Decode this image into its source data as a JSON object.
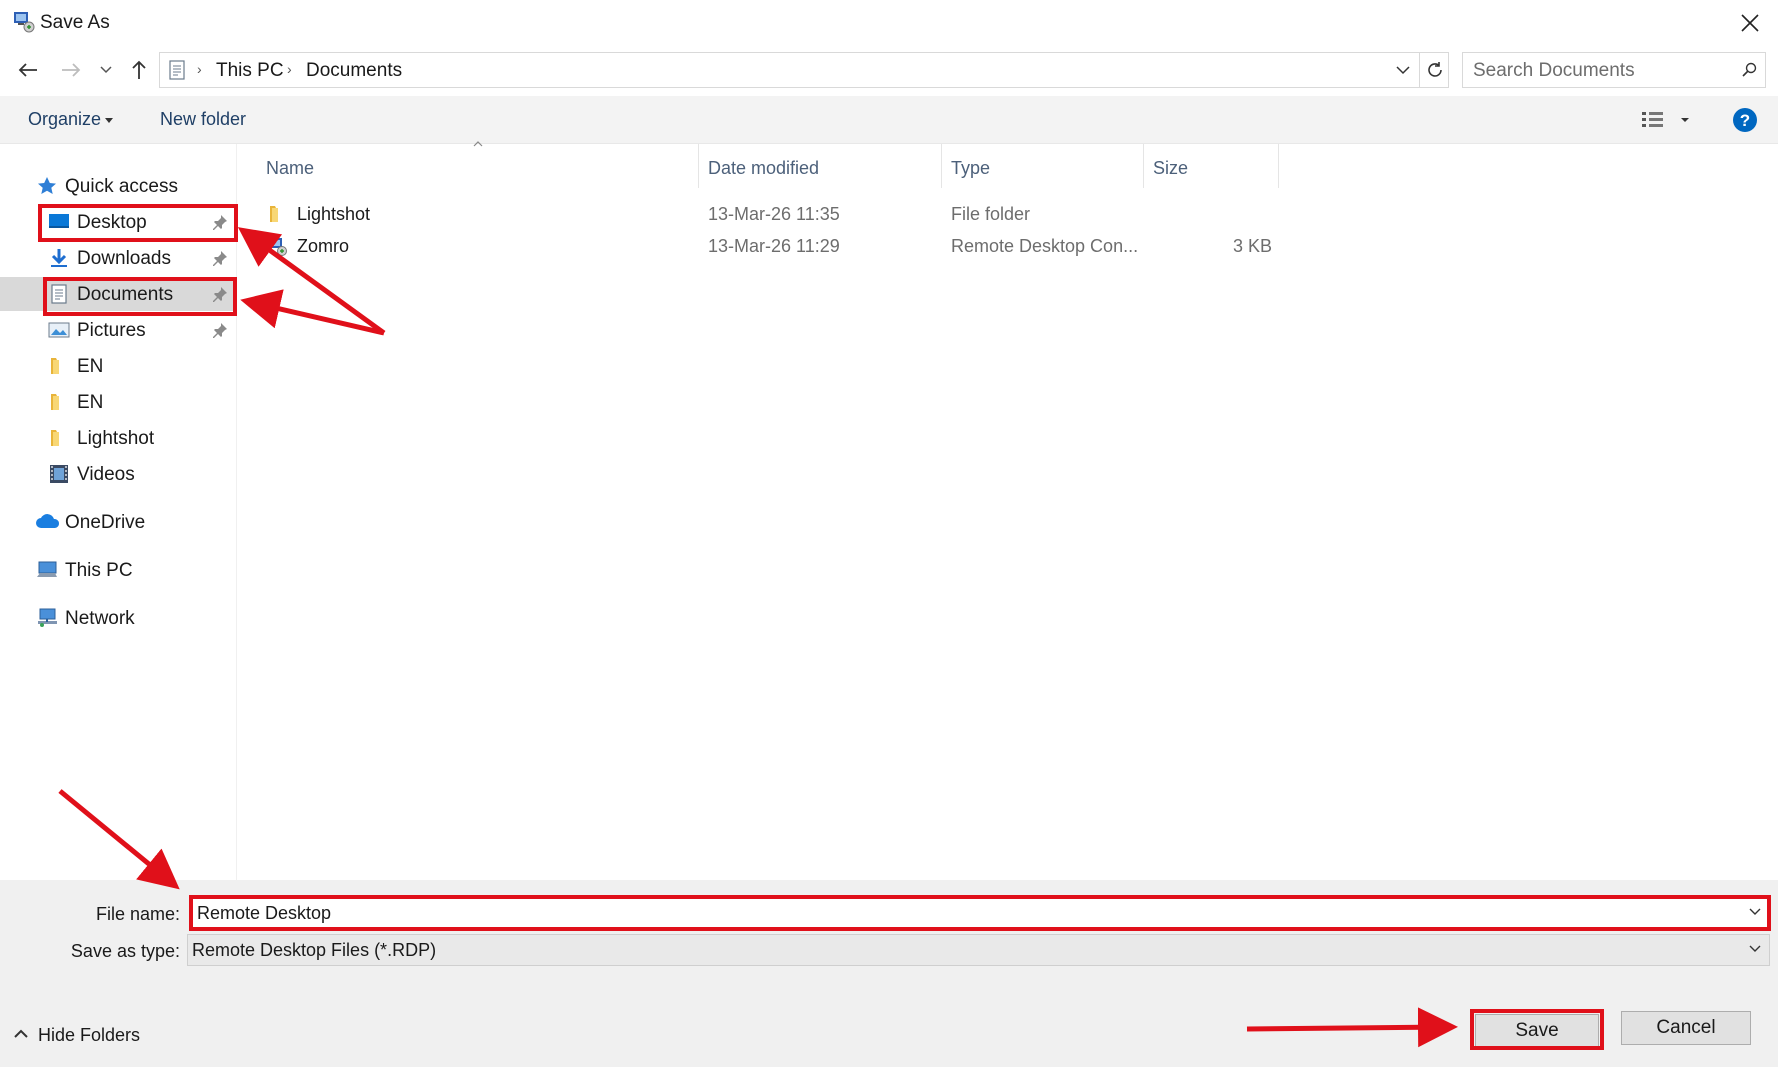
{
  "window": {
    "title": "Save As",
    "close_symbol": "✕"
  },
  "navigation": {
    "back_symbol": "←",
    "forward_symbol": "→",
    "recent_symbol": "⌄",
    "up_symbol": "↑",
    "breadcrumb": [
      "This PC",
      "Documents"
    ],
    "refresh_symbol": "↻"
  },
  "search": {
    "placeholder": "Search Documents"
  },
  "toolbar": {
    "organize_label": "Organize",
    "new_folder_label": "New folder",
    "help_symbol": "?"
  },
  "sidebar": {
    "quick_access": "Quick access",
    "items": [
      {
        "label": "Desktop",
        "pinned": true,
        "icon": "desktop-icon"
      },
      {
        "label": "Downloads",
        "pinned": true,
        "icon": "downloads-icon"
      },
      {
        "label": "Documents",
        "pinned": true,
        "icon": "documents-icon",
        "selected": true
      },
      {
        "label": "Pictures",
        "pinned": true,
        "icon": "pictures-icon"
      },
      {
        "label": "EN",
        "pinned": false,
        "icon": "folder-icon"
      },
      {
        "label": "EN",
        "pinned": false,
        "icon": "folder-icon"
      },
      {
        "label": "Lightshot",
        "pinned": false,
        "icon": "folder-icon"
      },
      {
        "label": "Videos",
        "pinned": false,
        "icon": "videos-icon"
      }
    ],
    "onedrive": "OneDrive",
    "this_pc": "This PC",
    "network": "Network"
  },
  "file_list": {
    "columns": [
      "Name",
      "Date modified",
      "Type",
      "Size"
    ],
    "rows": [
      {
        "name": "Lightshot",
        "date": "13-Mar-26 11:35",
        "type": "File folder",
        "size": "",
        "icon": "folder-icon"
      },
      {
        "name": "Zomro",
        "date": "13-Mar-26 11:29",
        "type": "Remote Desktop Con...",
        "size": "3 KB",
        "icon": "rdp-file-icon"
      }
    ]
  },
  "form": {
    "file_name_label": "File name:",
    "file_name_value": "Remote Desktop",
    "save_as_type_label": "Save as type:",
    "save_as_type_value": "Remote Desktop Files (*.RDP)"
  },
  "footer": {
    "hide_folders_label": "Hide Folders",
    "save_label": "Save",
    "cancel_label": "Cancel"
  },
  "colors": {
    "annotation_red": "#e0101a",
    "link_blue": "#1f3f66",
    "selection_gray": "#d9d9d9",
    "help_blue": "#0067c0"
  }
}
